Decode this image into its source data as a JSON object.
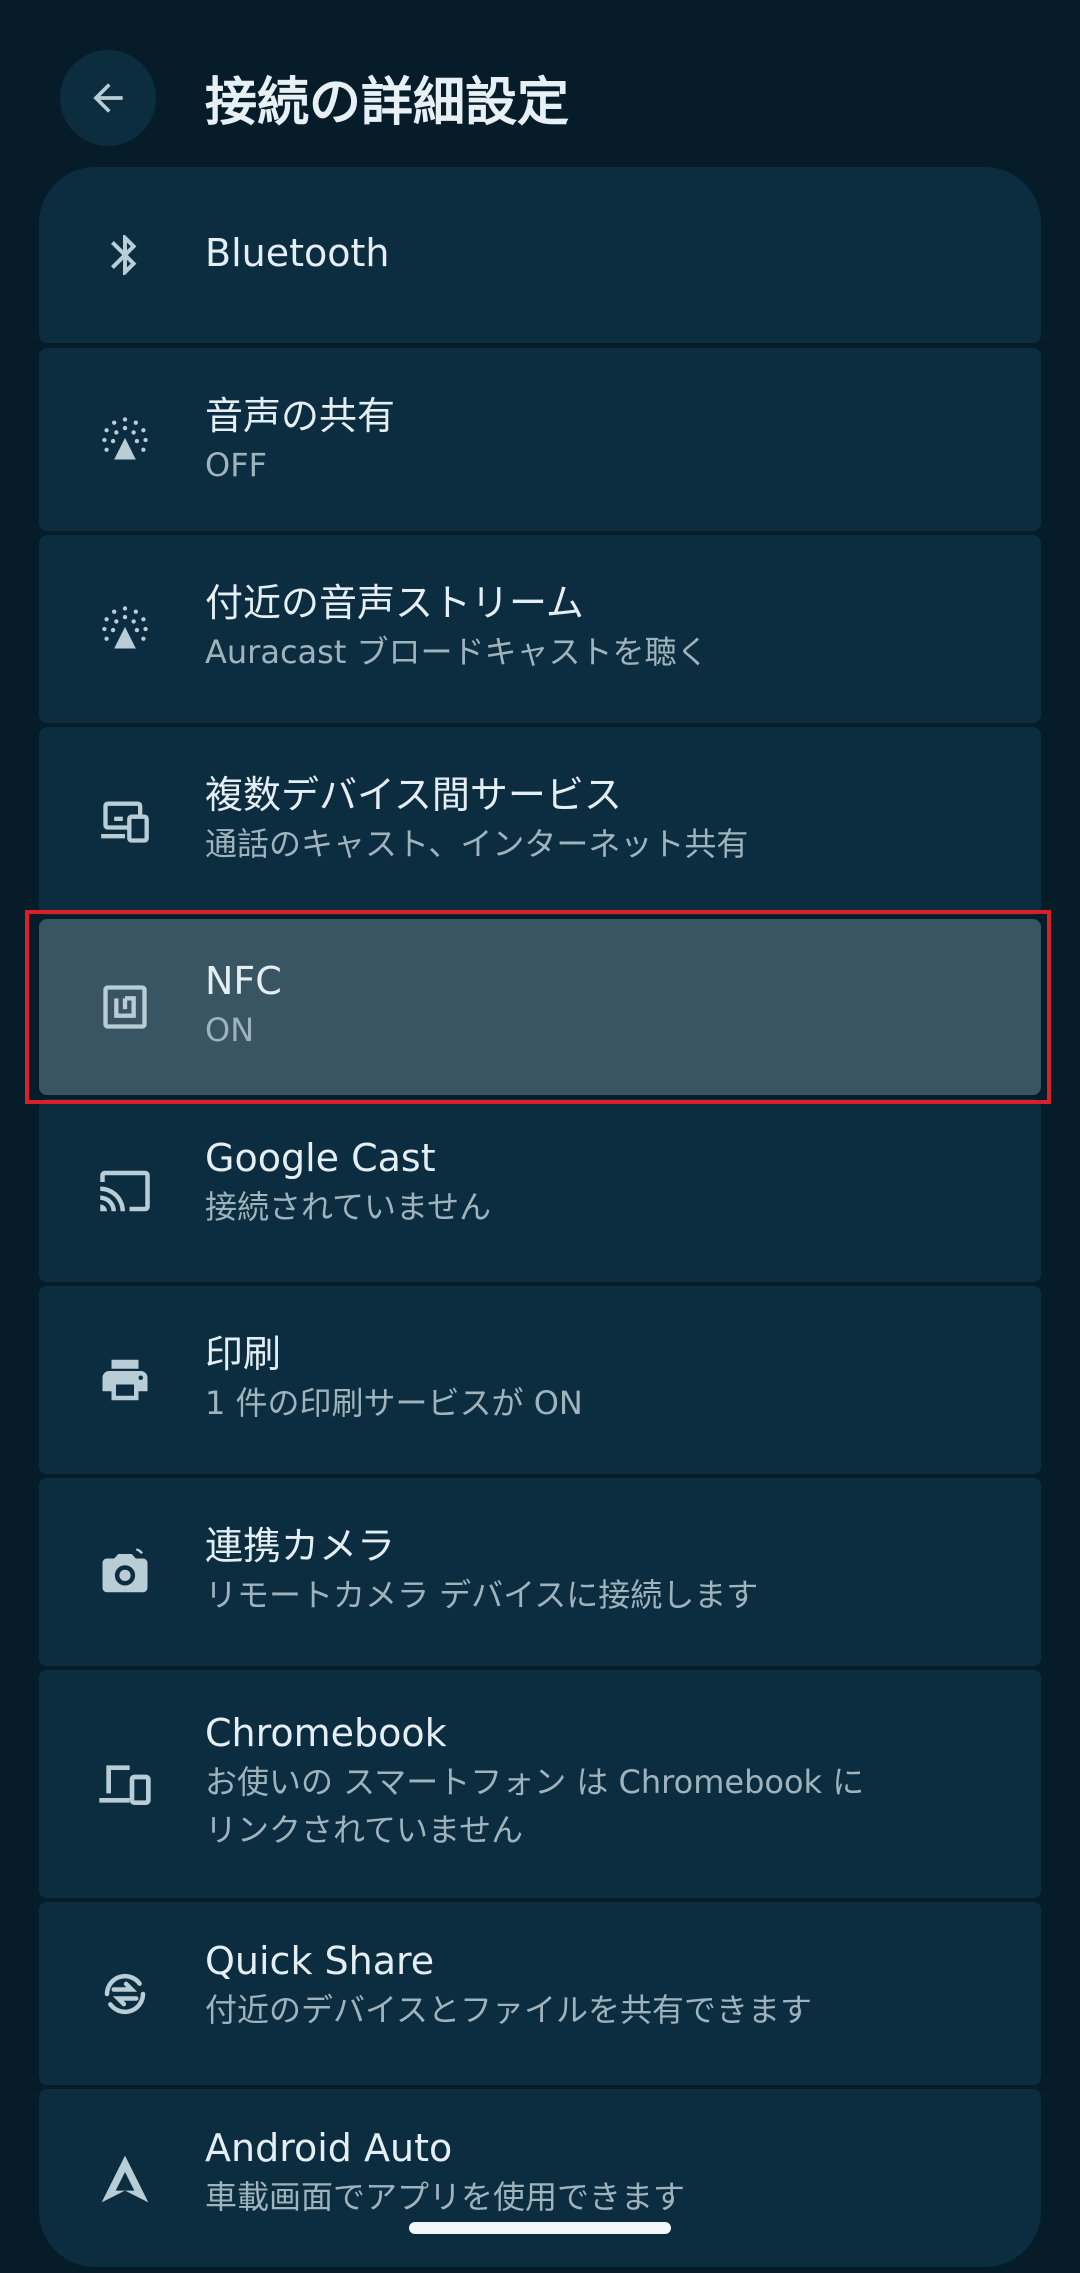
{
  "header": {
    "title": "接続の詳細設定",
    "back_icon": "arrow-back-icon"
  },
  "items": [
    {
      "title": "Bluetooth",
      "summary": "",
      "icon": "bluetooth-icon"
    },
    {
      "title": "音声の共有",
      "summary": "OFF",
      "icon": "audio-sharing-icon"
    },
    {
      "title": "付近の音声ストリーム",
      "summary": "Auracast ブロードキャストを聴く",
      "icon": "audio-stream-icon"
    },
    {
      "title": "複数デバイス間サービス",
      "summary": "通話のキャスト、インターネット共有",
      "icon": "cross-device-icon"
    },
    {
      "title": "NFC",
      "summary": "ON",
      "icon": "nfc-icon"
    },
    {
      "title": "Google Cast",
      "summary": "接続されていません",
      "icon": "cast-icon"
    },
    {
      "title": "印刷",
      "summary": "1 件の印刷サービスが ON",
      "icon": "print-icon"
    },
    {
      "title": "連携カメラ",
      "summary": "リモートカメラ デバイスに接続します",
      "icon": "camera-icon"
    },
    {
      "title": "Chromebook",
      "summary": "お使いの スマートフォン は Chromebook に\nリンクされていません",
      "summary_line1": "お使いの スマートフォン は Chromebook に",
      "summary_line2": "リンクされていません",
      "icon": "chromebook-icon"
    },
    {
      "title": "Quick Share",
      "summary": "付近のデバイスとファイルを共有できます",
      "icon": "quick-share-icon"
    },
    {
      "title": "Android Auto",
      "summary": "車載画面でアプリを使用できます",
      "icon": "android-auto-icon"
    }
  ],
  "colors": {
    "background": "#061d29",
    "card": "#0b2d3f",
    "selected_card": "#395463",
    "highlight_border": "#d9202a",
    "icon": "#b8cdd6"
  }
}
